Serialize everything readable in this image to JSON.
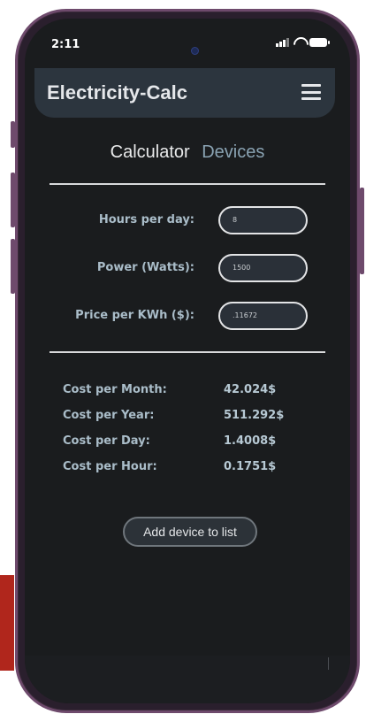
{
  "status_bar": {
    "time": "2:11"
  },
  "app_bar": {
    "title": "Electricity-Calc"
  },
  "tabs": [
    {
      "label": "Calculator",
      "active": true
    },
    {
      "label": "Devices",
      "active": false
    }
  ],
  "form": {
    "hours_per_day": {
      "label": "Hours per day:",
      "value": "8"
    },
    "power_watts": {
      "label": "Power (Watts):",
      "value": "1500"
    },
    "price_per_kwh": {
      "label": "Price per KWh ($):",
      "value": ".11672"
    }
  },
  "results": {
    "month": {
      "label": "Cost per Month:",
      "value": "42.024$"
    },
    "year": {
      "label": "Cost per Year:",
      "value": "511.292$"
    },
    "day": {
      "label": "Cost per Day:",
      "value": "1.4008$"
    },
    "hour": {
      "label": "Cost per Hour:",
      "value": "0.1751$"
    }
  },
  "actions": {
    "add_device_label": "Add device to list"
  },
  "colors": {
    "background": "#1a1c1e",
    "app_bar": "#2c353e",
    "label": "#aabdc9",
    "inactive_tab": "#8aa3b3",
    "phone_frame": "#6e4a6c",
    "side_block": "#b0261c"
  }
}
